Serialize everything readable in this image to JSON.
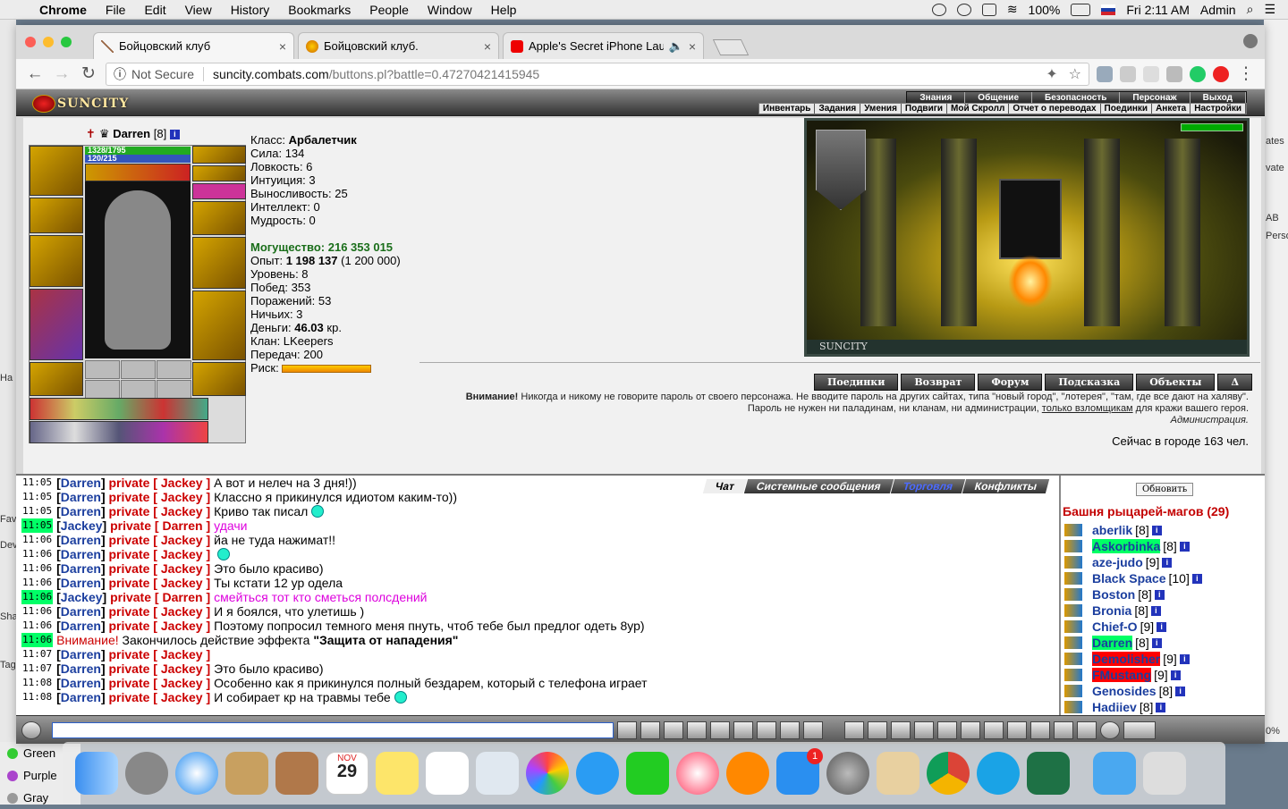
{
  "menubar": {
    "app": "Chrome",
    "items": [
      "File",
      "Edit",
      "View",
      "History",
      "Bookmarks",
      "People",
      "Window",
      "Help"
    ],
    "battery": "100%",
    "clock": "Fri 2:11 AM",
    "user": "Admin"
  },
  "tabs": [
    {
      "title": "Бойцовский клуб"
    },
    {
      "title": "Бойцовский клуб."
    },
    {
      "title": "Apple's Secret iPhone Laun"
    }
  ],
  "address": {
    "secure": "Not Secure",
    "host": "suncity.combats.com",
    "path": "/buttons.pl?battle=0.47270421415945"
  },
  "game": {
    "logo": "SUNCITY",
    "topnav1": [
      "Знания",
      "Общение",
      "Безопасность",
      "Персонаж",
      "Выход"
    ],
    "topnav2": [
      "Инвентарь",
      "Задания",
      "Умения",
      "Подвиги",
      "Мой Скролл",
      "Отчет о переводах",
      "Поединки",
      "Анкета",
      "Настройки"
    ]
  },
  "character": {
    "name": "Darren",
    "level": "[8]",
    "hp": "1328/1795",
    "mana": "120/215",
    "stats": {
      "class_label": "Класс:",
      "class": "Арбалетчик",
      "str": "Сила: 134",
      "agi": "Ловкость: 6",
      "int": "Интуиция: 3",
      "end": "Выносливость: 25",
      "intel": "Интеллект: 0",
      "wis": "Мудрость: 0",
      "power": "Могущество: 216 353 015",
      "exp_label": "Опыт:",
      "exp": "1 198 137",
      "exp_next": "(1 200 000)",
      "level": "Уровень: 8",
      "wins": "Побед: 353",
      "losses": "Поражений: 53",
      "draws": "Ничьих: 3",
      "money_label": "Деньги:",
      "money": "46.03",
      "money_unit": "кр.",
      "clan": "Клан: LKeepers",
      "transfers": "Передач: 200",
      "risk": "Риск:"
    }
  },
  "room": {
    "caption": "SUNCITY"
  },
  "game_buttons": [
    "Поединки",
    "Возврат",
    "Форум",
    "Подсказка",
    "Объекты",
    "Δ"
  ],
  "warning": {
    "bold": "Внимание!",
    "line1": " Никогда и никому не говорите пароль от своего персонажа. Не вводите пароль на других сайтах, типа \"новый город\", \"лотерея\", \"там, где все дают на халяву\".",
    "line2a": "Пароль не нужен ни паладинам, ни кланам, ни администрации, ",
    "line2u": "только взломщикам",
    "line2b": " для кражи вашего героя.",
    "sign": "Администрация.",
    "online": "Сейчас в городе 163 чел."
  },
  "chat_tabs": [
    "Чат",
    "Системные сообщения",
    "Торговля",
    "Конфликты"
  ],
  "chat": [
    {
      "t": "11:05",
      "who": "Darren",
      "to": "Jackey",
      "msg": "А вот и нелеч на 3 дня!))",
      "kind": "normal"
    },
    {
      "t": "11:05",
      "who": "Darren",
      "to": "Jackey",
      "msg": "Классно я прикинулся идиотом каким-то))",
      "kind": "normal"
    },
    {
      "t": "11:05",
      "who": "Darren",
      "to": "Jackey",
      "msg": "Криво так писал",
      "kind": "normal",
      "smile": true
    },
    {
      "t": "11:05",
      "who": "Jackey",
      "to": "Darren",
      "msg": "удачи",
      "kind": "in",
      "hl": true
    },
    {
      "t": "11:06",
      "who": "Darren",
      "to": "Jackey",
      "msg": "йа не туда нажимат!!",
      "kind": "normal"
    },
    {
      "t": "11:06",
      "who": "Darren",
      "to": "Jackey",
      "msg": "",
      "kind": "normal",
      "smile": true
    },
    {
      "t": "11:06",
      "who": "Darren",
      "to": "Jackey",
      "msg": "Это было красиво)",
      "kind": "normal"
    },
    {
      "t": "11:06",
      "who": "Darren",
      "to": "Jackey",
      "msg": "Ты кстати 12 ур одела",
      "kind": "normal"
    },
    {
      "t": "11:06",
      "who": "Jackey",
      "to": "Darren",
      "msg": "смейться тот кто сметься полсдений",
      "kind": "in",
      "hl": true
    },
    {
      "t": "11:06",
      "who": "Darren",
      "to": "Jackey",
      "msg": "И я боялся, что улетишь )",
      "kind": "normal"
    },
    {
      "t": "11:06",
      "who": "Darren",
      "to": "Jackey",
      "msg": "Поэтому попросил темного меня пнуть, чтоб тебе был предлог одеть 8ур)",
      "kind": "normal"
    },
    {
      "t": "11:06",
      "sys": true,
      "label": "Внимание!",
      "msg": " Закончилось действие эффекта ",
      "effect": "\"Защита от нападения\"",
      "hl": true
    },
    {
      "t": "11:07",
      "who": "Darren",
      "to": "Jackey",
      "msg": "",
      "kind": "normal"
    },
    {
      "t": "11:07",
      "who": "Darren",
      "to": "Jackey",
      "msg": "Это было красиво)",
      "kind": "normal"
    },
    {
      "t": "11:08",
      "who": "Darren",
      "to": "Jackey",
      "msg": "Особенно как я прикинулся полный бездарем, который с телефона играет",
      "kind": "normal"
    },
    {
      "t": "11:08",
      "who": "Darren",
      "to": "Jackey",
      "msg": "И собирает кр на травмы тебе",
      "kind": "normal",
      "smile": true
    }
  ],
  "private_word": "private",
  "side": {
    "refresh": "Обновить",
    "title": "Башня рыцарей-магов (29)",
    "players": [
      {
        "n": "aberlik",
        "l": "[8]"
      },
      {
        "n": "Askorbinka",
        "l": "[8]",
        "g": true
      },
      {
        "n": "aze-judo",
        "l": "[9]"
      },
      {
        "n": "Black Space",
        "l": "[10]"
      },
      {
        "n": "Boston",
        "l": "[8]"
      },
      {
        "n": "Bronia",
        "l": "[8]"
      },
      {
        "n": "Chief-O",
        "l": "[9]"
      },
      {
        "n": "Darren",
        "l": "[8]",
        "g": true
      },
      {
        "n": "Demolisher",
        "l": "[9]",
        "r": true
      },
      {
        "n": "FMustang",
        "l": "[9]",
        "r": true
      },
      {
        "n": "Genosides",
        "l": "[8]"
      },
      {
        "n": "Hadiiev",
        "l": "[8]"
      }
    ]
  },
  "mac": {
    "left_labels": [
      "Green",
      "Purple",
      "Gray"
    ],
    "right_labels": [
      "ates",
      "vate",
      "AB",
      "Perso",
      "0%"
    ],
    "left_side": [
      "Ha",
      "Fav",
      "Dev",
      "Sha",
      "Tag"
    ],
    "calendar_month": "NOV",
    "calendar_day": "29",
    "badge": "1"
  }
}
